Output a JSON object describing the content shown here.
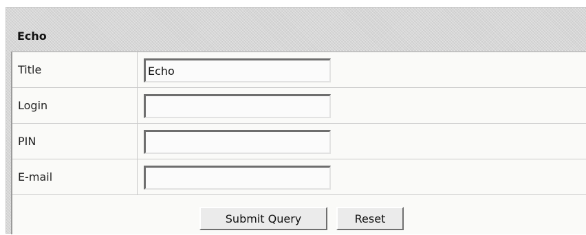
{
  "panel": {
    "title": "Echo"
  },
  "form": {
    "fields": [
      {
        "label": "Title",
        "value": "Echo",
        "placeholder": ""
      },
      {
        "label": "Login",
        "value": "",
        "placeholder": ""
      },
      {
        "label": "PIN",
        "value": "",
        "placeholder": ""
      },
      {
        "label": "E-mail",
        "value": "",
        "placeholder": ""
      }
    ],
    "submit_label": "Submit Query",
    "reset_label": "Reset"
  }
}
